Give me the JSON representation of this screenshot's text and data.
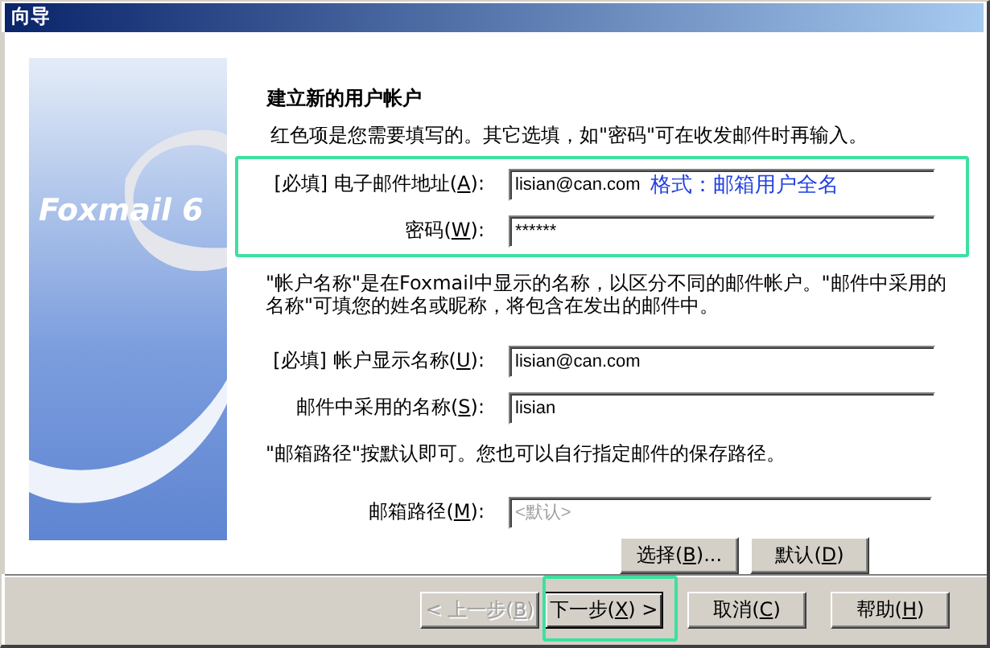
{
  "window": {
    "title": "向导"
  },
  "sidebar": {
    "logo_text": "Foxmail 6"
  },
  "heading": "建立新的用户帐户",
  "intro": "红色项是您需要填写的。其它选填，如\"密码\"可在收发邮件时再输入。",
  "account_fields": [
    {
      "label": {
        "before": "[必填] 电子邮件地址(",
        "key": "A",
        "after": "):"
      },
      "value": "lisian@can.com",
      "note": "格式：邮箱用户全名"
    },
    {
      "label": {
        "before": "密码(",
        "key": "W",
        "after": "):"
      },
      "value": "******"
    }
  ],
  "name_hint": "\"帐户名称\"是在Foxmail中显示的名称，以区分不同的邮件帐户。\"邮件中采用的名称\"可填您的姓名或昵称，将包含在发出的邮件中。",
  "name_fields": [
    {
      "label": {
        "before": "[必填] 帐户显示名称(",
        "key": "U",
        "after": "):"
      },
      "value": "lisian@can.com"
    },
    {
      "label": {
        "before": "邮件中采用的名称(",
        "key": "S",
        "after": "):"
      },
      "value": "lisian"
    }
  ],
  "path_hint": "\"邮箱路径\"按默认即可。您也可以自行指定邮件的保存路径。",
  "path_field": {
    "label": {
      "before": "邮箱路径(",
      "key": "M",
      "after": "):"
    },
    "placeholder": "<默认>"
  },
  "path_buttons": [
    {
      "label": {
        "before": "选择(",
        "key": "B",
        "after": ")..."
      }
    },
    {
      "label": {
        "before": "默认(",
        "key": "D",
        "after": ")"
      }
    }
  ],
  "footer_buttons": [
    {
      "label": {
        "before": "< 上一步(",
        "key": "B",
        "after": ")"
      },
      "disabled": true,
      "default": false
    },
    {
      "label": {
        "before": "下一步(",
        "key": "X",
        "after": ") >"
      },
      "disabled": false,
      "default": true
    },
    {
      "label": {
        "before": "取消(",
        "key": "C",
        "after": ")"
      },
      "disabled": false,
      "default": false
    },
    {
      "label": {
        "before": "帮助(",
        "key": "H",
        "after": ")"
      },
      "disabled": false,
      "default": false
    }
  ]
}
